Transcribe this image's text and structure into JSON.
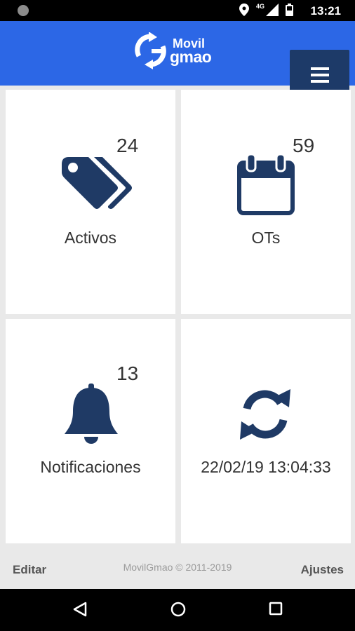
{
  "status_bar": {
    "time": "13:21",
    "network": "4G",
    "icons": [
      "location-icon",
      "signal-icon",
      "battery-icon"
    ]
  },
  "app_bar": {
    "logo_line1": "Movil",
    "logo_line2": "gmao",
    "menu_icon": "hamburger-menu-icon",
    "colors": {
      "background": "#2c67e6",
      "menu_button": "#1d3a68"
    }
  },
  "tiles": [
    {
      "label": "Activos",
      "count": "24",
      "icon": "tags-icon"
    },
    {
      "label": "OTs",
      "count": "59",
      "icon": "calendar-icon"
    },
    {
      "label": "Notificaciones",
      "count": "13",
      "icon": "bell-icon"
    },
    {
      "label": "22/02/19 13:04:33",
      "count": "",
      "icon": "sync-icon"
    }
  ],
  "footer": {
    "edit": "Editar",
    "copyright": "MovilGmao © 2011-2019",
    "settings": "Ajustes"
  },
  "icon_color": "#1f3a65"
}
